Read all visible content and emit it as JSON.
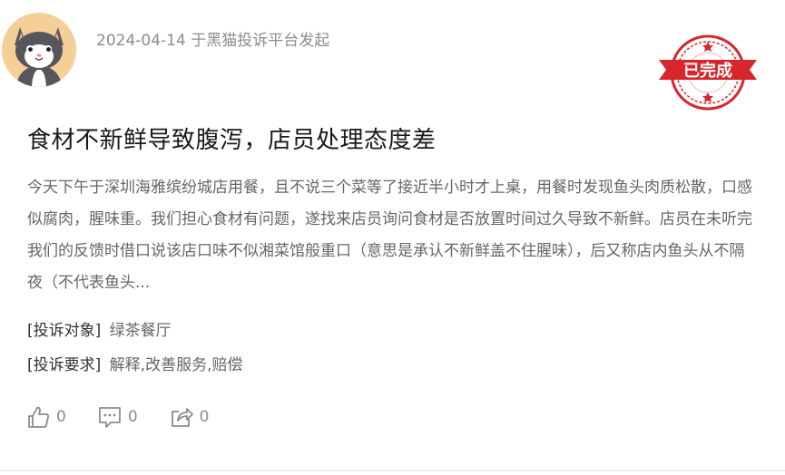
{
  "post": {
    "date": "2024-04-14",
    "platform_text": "于黑猫投诉平台发起",
    "status_badge": "已完成",
    "title": "食材不新鲜导致腹泻，店员处理态度差",
    "body": "今天下午于深圳海雅缤纷城店用餐，且不说三个菜等了接近半小时才上桌，用餐时发现鱼头肉质松散，口感似腐肉，腥味重。我们担心食材有问题，遂找来店员询问食材是否放置时间过久导致不新鲜。店员在未听完我们的反馈时借口说该店口味不似湘菜馆般重口（意思是承认不新鲜盖不住腥味），后又称店内鱼头从不隔夜（不代表鱼头...",
    "target_label": "[投诉对象]",
    "target_value": "绿茶餐厅",
    "request_label": "[投诉要求]",
    "request_value": "解释,改善服务,赔偿"
  },
  "actions": {
    "like_icon": "thumbs-up-icon",
    "like_count": "0",
    "comment_icon": "comment-icon",
    "comment_count": "0",
    "share_icon": "share-icon",
    "share_count": "0"
  },
  "colors": {
    "stamp_red": "#d7262c",
    "title_text": "#1a1a1a",
    "body_text": "#666666",
    "muted_text": "#8c8c8c"
  }
}
